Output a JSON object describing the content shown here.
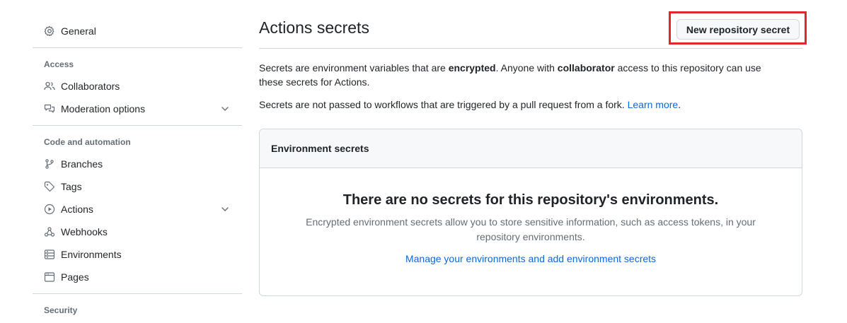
{
  "sidebar": {
    "general": "General",
    "groups": {
      "access": "Access",
      "code": "Code and automation",
      "security": "Security"
    },
    "items": {
      "collaborators": "Collaborators",
      "moderation": "Moderation options",
      "branches": "Branches",
      "tags": "Tags",
      "actions": "Actions",
      "webhooks": "Webhooks",
      "environments": "Environments",
      "pages": "Pages"
    }
  },
  "main": {
    "title": "Actions secrets",
    "new_button": "New repository secret",
    "intro": {
      "p1_a": "Secrets are environment variables that are ",
      "p1_b": "encrypted",
      "p1_c": ". Anyone with ",
      "p1_d": "collaborator",
      "p1_e": " access to this repository can use these secrets for Actions.",
      "p2_a": "Secrets are not passed to workflows that are triggered by a pull request from a fork. ",
      "p2_link": "Learn more",
      "p2_end": "."
    },
    "env_box": {
      "header": "Environment secrets",
      "empty_title": "There are no secrets for this repository's environments.",
      "empty_desc": "Encrypted environment secrets allow you to store sensitive information, such as access tokens, in your repository environments.",
      "manage_link": "Manage your environments and add environment secrets"
    }
  },
  "colors": {
    "link": "#0969da",
    "highlight": "#e3262a",
    "border": "#d0d7de",
    "muted": "#656d76"
  }
}
